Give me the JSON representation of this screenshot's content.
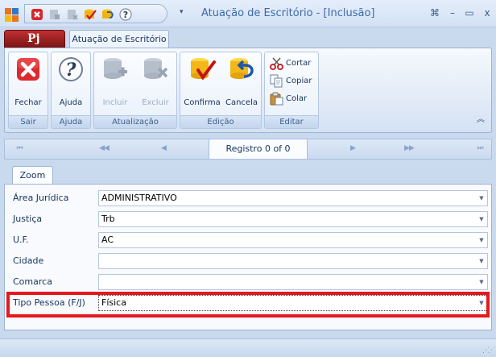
{
  "window": {
    "title": "Atuação de Escritório - [Inclusão]",
    "controls": {
      "restore": "⌘",
      "minimize": "–",
      "maximize": "▭",
      "close": "x"
    },
    "qat_arrow": "▾"
  },
  "ribbon": {
    "app_logo": "Pj",
    "tab_label": "Atuação de Escritório",
    "groups": {
      "sair": {
        "label": "Sair",
        "fechar": "Fechar"
      },
      "ajuda": {
        "label": "Ajuda",
        "ajuda": "Ajuda"
      },
      "atualizacao": {
        "label": "Atualização",
        "incluir": "Incluir",
        "excluir": "Excluir"
      },
      "edicao": {
        "label": "Edição",
        "confirma": "Confirma",
        "cancela": "Cancela"
      },
      "editar": {
        "label": "Editar",
        "cortar": "Cortar",
        "copiar": "Copiar",
        "colar": "Colar"
      }
    },
    "collapse_glyph": "︽"
  },
  "navigator": {
    "first": "⏮",
    "prev_page": "◀◀",
    "prev": "◀",
    "record_text": "Registro 0 of 0",
    "next": "▶",
    "next_page": "▶▶",
    "last": "⏭"
  },
  "form": {
    "tab_label": "Zoom",
    "fields": {
      "area_juridica": {
        "label": "Área Jurídica",
        "value": "ADMINISTRATIVO"
      },
      "justica": {
        "label": "Justiça",
        "value": "Trb"
      },
      "uf": {
        "label": "U.F.",
        "value": "AC"
      },
      "cidade": {
        "label": "Cidade",
        "value": ""
      },
      "comarca": {
        "label": "Comarca",
        "value": ""
      },
      "tipo_pessoa": {
        "label": "Tipo Pessoa (F/J)",
        "value": "Física"
      }
    },
    "dropdown_glyph": "▼"
  },
  "colors": {
    "highlight": "#e3191f",
    "brand_red": "#b02020",
    "title_blue": "#3e6aa8"
  },
  "icons": [
    "app-orb-icon",
    "close-x-icon",
    "help-question-icon",
    "add-record-icon",
    "delete-record-icon",
    "confirm-check-icon",
    "cancel-undo-icon",
    "scissors-icon",
    "copy-icon",
    "paste-icon"
  ]
}
